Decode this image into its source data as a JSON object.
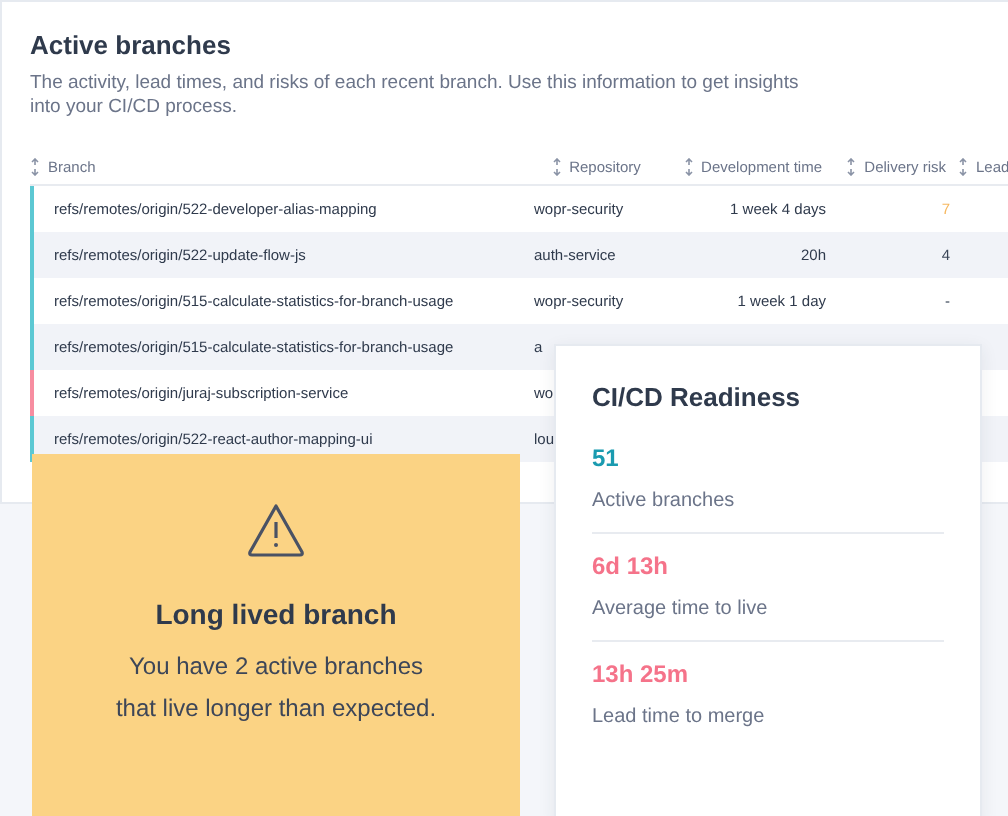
{
  "panel": {
    "title": "Active branches",
    "description": "The activity, lead times, and risks of each recent branch. Use this information to get insights into your CI/CD process."
  },
  "table": {
    "columns": [
      "Branch",
      "Repository",
      "Development time",
      "Delivery risk",
      "Lead"
    ],
    "rows": [
      {
        "color": "#5cc8d3",
        "branch": "refs/remotes/origin/522-developer-alias-mapping",
        "repository": "wopr-security",
        "development_time": "1 week 4 days",
        "delivery_risk": {
          "value": "7",
          "color": "#f6b860"
        }
      },
      {
        "color": "#5cc8d3",
        "branch": "refs/remotes/origin/522-update-flow-js",
        "repository": "auth-service",
        "development_time": "20h",
        "delivery_risk": {
          "value": "4",
          "color": "#3b4658"
        }
      },
      {
        "color": "#5cc8d3",
        "branch": "refs/remotes/origin/515-calculate-statistics-for-branch-usage",
        "repository": "wopr-security",
        "development_time": "1 week 1 day",
        "delivery_risk": {
          "value": "-"
        }
      },
      {
        "color": "#5cc8d3",
        "branch": "refs/remotes/origin/515-calculate-statistics-for-branch-usage",
        "repository": "a"
      },
      {
        "color": "#f78da0",
        "branch": "refs/remotes/origin/juraj-subscription-service",
        "repository": "wo"
      },
      {
        "color": "#5cc8d3",
        "branch": "refs/remotes/origin/522-react-author-mapping-ui",
        "repository": "lou"
      }
    ]
  },
  "alert": {
    "title": "Long lived branch",
    "message": "You have 2 active branches that live longer than expected."
  },
  "readiness": {
    "title": "CI/CD Readiness",
    "metrics": [
      {
        "value": "51",
        "label": "Active branches",
        "color": "#1a9bb0"
      },
      {
        "value": "6d 13h",
        "label": "Average time to live",
        "color": "#f5738a"
      },
      {
        "value": "13h 25m",
        "label": "Lead time to merge",
        "color": "#f5738a"
      }
    ]
  }
}
